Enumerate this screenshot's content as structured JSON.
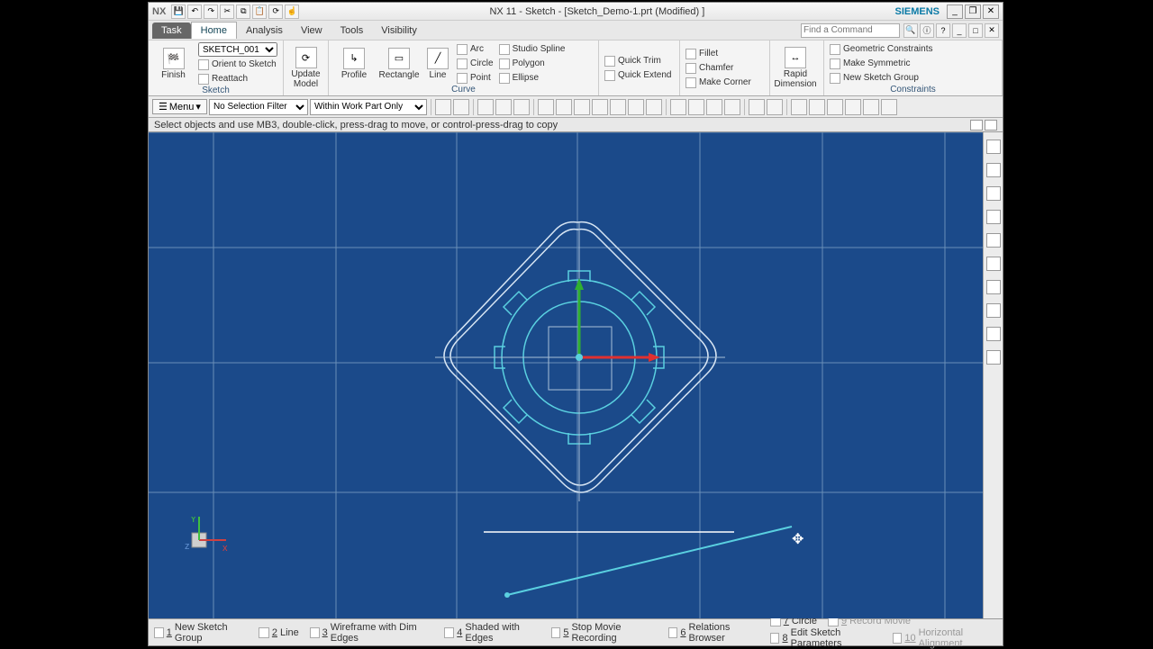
{
  "titlebar": {
    "logo": "NX",
    "title": "NX 11 - Sketch - [Sketch_Demo-1.prt (Modified) ]",
    "brand": "SIEMENS"
  },
  "menubar": {
    "tabs": [
      "Task",
      "Home",
      "Analysis",
      "View",
      "Tools",
      "Visibility"
    ],
    "active": 1,
    "search_placeholder": "Find a Command"
  },
  "ribbon": {
    "finish": "Finish",
    "sketchname": "SKETCH_001",
    "orient": "Orient to Sketch",
    "reattach": "Reattach",
    "update": "Update Model",
    "profile": "Profile",
    "rectangle": "Rectangle",
    "line": "Line",
    "arc": "Arc",
    "circle": "Circle",
    "point": "Point",
    "spline": "Studio Spline",
    "polygon": "Polygon",
    "ellipse": "Ellipse",
    "curve_lbl": "Curve",
    "qtrim": "Quick Trim",
    "qextend": "Quick Extend",
    "fillet": "Fillet",
    "chamfer": "Chamfer",
    "corner": "Make Corner",
    "rapid": "Rapid Dimension",
    "geo": "Geometric Constraints",
    "sym": "Make Symmetric",
    "newgrp": "New Sketch Group",
    "sketch_lbl": "Sketch",
    "constraints_lbl": "Constraints"
  },
  "filterbar": {
    "menu": "Menu",
    "selfilter": "No Selection Filter",
    "scope": "Within Work Part Only"
  },
  "hint": "Select objects and use MB3, double-click, press-drag to move, or control-press-drag to copy",
  "bottombar": {
    "b1": {
      "n": "1",
      "t": "New Sketch Group"
    },
    "b2": {
      "n": "2",
      "t": "Line"
    },
    "b3": {
      "n": "3",
      "t": "Wireframe with Dim Edges"
    },
    "b4": {
      "n": "4",
      "t": "Shaded with Edges"
    },
    "b5": {
      "n": "5",
      "t": "Stop Movie Recording"
    },
    "b6": {
      "n": "6",
      "t": "Relations Browser"
    },
    "b7": {
      "n": "7",
      "t": "Circle"
    },
    "b8": {
      "n": "8",
      "t": "Edit Sketch Parameters"
    },
    "b9": {
      "n": "9",
      "t": "Record Movie"
    },
    "b10": {
      "n": "10",
      "t": "Horizontal Alignment"
    }
  },
  "chart_data": null
}
